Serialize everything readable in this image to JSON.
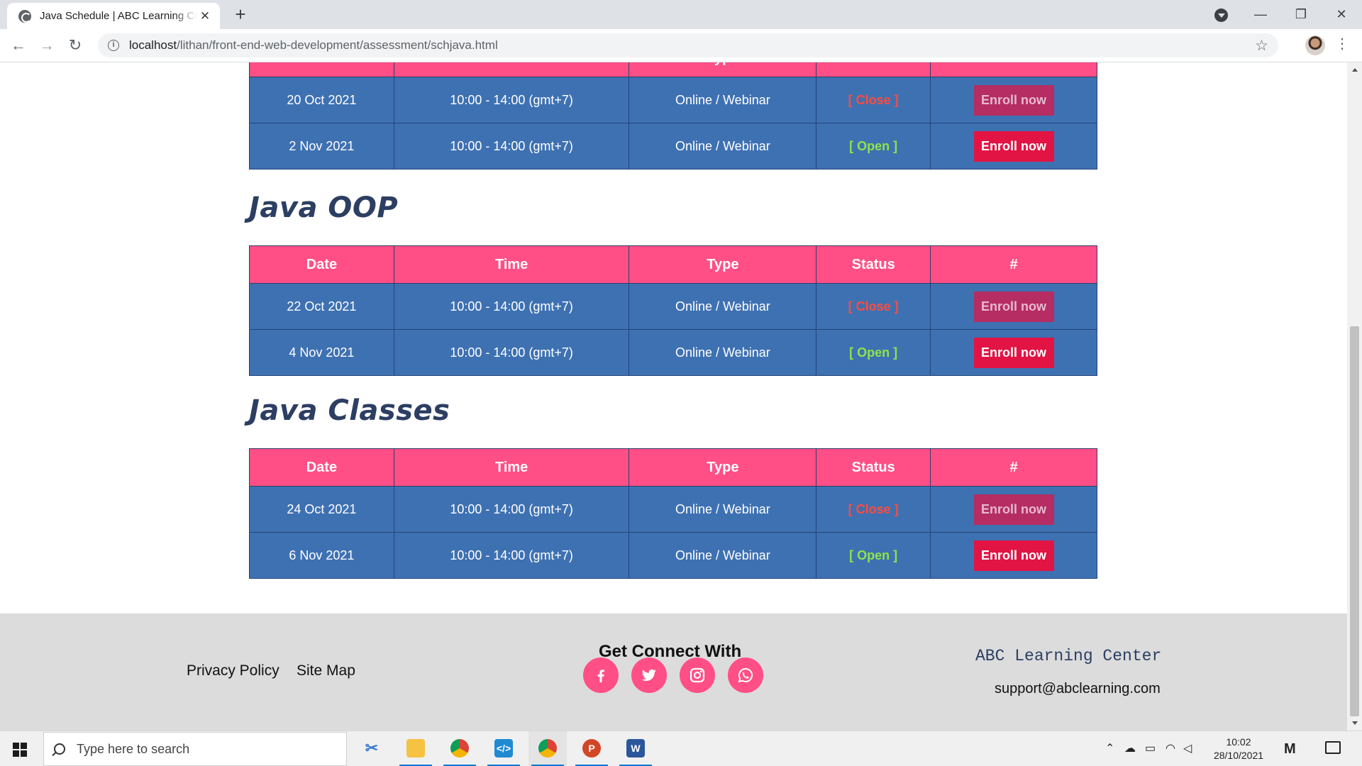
{
  "browser": {
    "tab_title": "Java Schedule | ABC Learning Center",
    "tab_close": "✕",
    "new_tab": "+",
    "url_host": "localhost",
    "url_path": "/lithan/front-end-web-development/assessment/schjava.html",
    "window_controls": {
      "minimize": "—",
      "restore": "❐",
      "close": "✕"
    }
  },
  "table_headers": [
    "Date",
    "Time",
    "Type",
    "Status",
    "#"
  ],
  "sections": [
    {
      "title": "",
      "rows": [
        {
          "date": "20 Oct 2021",
          "time": "10:00 - 14:00 (gmt+7)",
          "type": "Online / Webinar",
          "status": "[ Close ]",
          "action": "Enroll now",
          "open": false
        },
        {
          "date": "2 Nov 2021",
          "time": "10:00 - 14:00 (gmt+7)",
          "type": "Online / Webinar",
          "status": "[ Open ]",
          "action": "Enroll now",
          "open": true
        }
      ]
    },
    {
      "title": "Java OOP",
      "rows": [
        {
          "date": "22 Oct 2021",
          "time": "10:00 - 14:00 (gmt+7)",
          "type": "Online / Webinar",
          "status": "[ Close ]",
          "action": "Enroll now",
          "open": false
        },
        {
          "date": "4 Nov 2021",
          "time": "10:00 - 14:00 (gmt+7)",
          "type": "Online / Webinar",
          "status": "[ Open ]",
          "action": "Enroll now",
          "open": true
        }
      ]
    },
    {
      "title": "Java Classes",
      "rows": [
        {
          "date": "24 Oct 2021",
          "time": "10:00 - 14:00 (gmt+7)",
          "type": "Online / Webinar",
          "status": "[ Close ]",
          "action": "Enroll now",
          "open": false
        },
        {
          "date": "6 Nov 2021",
          "time": "10:00 - 14:00 (gmt+7)",
          "type": "Online / Webinar",
          "status": "[ Open ]",
          "action": "Enroll now",
          "open": true
        }
      ]
    }
  ],
  "footer": {
    "links": [
      "Privacy Policy",
      "Site Map"
    ],
    "connect_title": "Get Connect With",
    "social": [
      "facebook-icon",
      "twitter-icon",
      "instagram-icon",
      "whatsapp-icon"
    ],
    "brand": "ABC Learning Center",
    "email": "support@abclearning.com"
  },
  "taskbar": {
    "search_placeholder": "Type here to search",
    "time": "10:02",
    "date": "28/10/2021"
  },
  "colors": {
    "header_pink": "#ff4f86",
    "row_blue": "#3e71b2",
    "enroll_red": "#e11444",
    "status_close": "#ff4b3e",
    "status_open": "#8ee34a",
    "title_navy": "#2c3e62"
  }
}
